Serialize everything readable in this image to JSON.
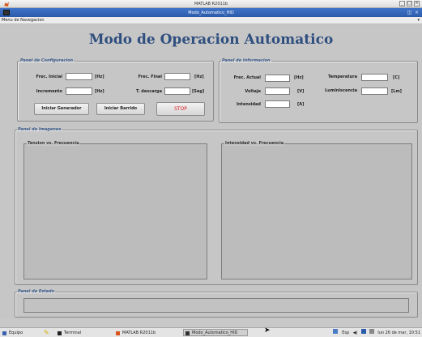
{
  "os_window": {
    "title": "MATLAB R2011b"
  },
  "figure_window": {
    "title": "Modo_Automatico_HID"
  },
  "menu": {
    "label": "Menu de Navegacion"
  },
  "main_title": "Modo de Operacion Automatico",
  "config_panel": {
    "title": "Panel de Configuracion",
    "frec_inicial_label": "Frec. Inicial",
    "frec_inicial_unit": "[Hz]",
    "frec_inicial_value": "",
    "frec_final_label": "Frec. Final",
    "frec_final_unit": "[Hz]",
    "frec_final_value": "",
    "incremento_label": "Incremento",
    "incremento_unit": "[Hz]",
    "incremento_value": "",
    "t_descarga_label": "T. descarga",
    "t_descarga_unit": "[Seg]",
    "t_descarga_value": "",
    "btn_generador": "Iniciar Generador",
    "btn_barrido": "Iniciar Barrido",
    "btn_stop": "STOP",
    "stop_color": "#e01818"
  },
  "info_panel": {
    "title": "Panel de Informacion",
    "frec_actual_label": "Frec. Actual",
    "frec_actual_unit": "[Hz]",
    "voltaje_label": "Voltaje",
    "voltaje_unit": "[V]",
    "intensidad_label": "Intensidad",
    "intensidad_unit": "[A]",
    "temperatura_label": "Temperatura",
    "temperatura_unit": "[C]",
    "luminiscencia_label": "Luminiscencia",
    "luminiscencia_unit": "[Lm]"
  },
  "images_panel": {
    "title": "Panel de Imagenes",
    "plot_left_title": "Tension vs. Frecuencia",
    "plot_right_title": "Intensidad vs. Frecuencia"
  },
  "status_panel": {
    "title": "Panel de Estado",
    "text": ""
  },
  "taskbar": {
    "start_label": "Equipo",
    "tasks": [
      "Terminal",
      "MATLAB R2011b",
      "Modo_Automatico_HID"
    ],
    "tray_text": "Esp",
    "clock": "lun 26 de mar, 10:51"
  },
  "colors": {
    "title_text": "#2f4f7f",
    "titlebar": "#2c5aa8",
    "panel_legend": "#3b5b8a"
  }
}
